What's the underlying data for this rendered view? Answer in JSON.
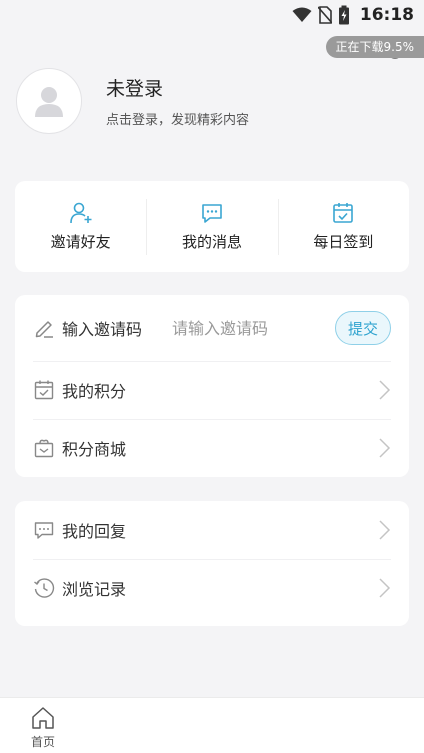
{
  "statusbar": {
    "time": "16:18",
    "download_toast": "正在下载9.5%",
    "icons": [
      "wifi-icon",
      "no-sim-icon",
      "battery-charging-icon"
    ]
  },
  "profile": {
    "name": "未登录",
    "subtitle": "点击登录，发现精彩内容"
  },
  "quick_actions": [
    {
      "label": "邀请好友",
      "icon": "add-user-icon"
    },
    {
      "label": "我的消息",
      "icon": "message-icon"
    },
    {
      "label": "每日签到",
      "icon": "calendar-check-icon"
    }
  ],
  "invite": {
    "label": "输入邀请码",
    "placeholder": "请输入邀请码",
    "submit": "提交"
  },
  "menu1": [
    {
      "label": "我的积分",
      "icon": "points-calendar-icon"
    },
    {
      "label": "积分商城",
      "icon": "shop-gift-icon"
    }
  ],
  "menu2": [
    {
      "label": "我的回复",
      "icon": "reply-icon"
    },
    {
      "label": "浏览记录",
      "icon": "history-icon"
    }
  ],
  "tabbar": {
    "home": "首页"
  },
  "colors": {
    "accent": "#2fa3cf",
    "accent_border": "#8fd0e8",
    "icon": "#3aa6d2",
    "background": "#f4f4f6"
  }
}
